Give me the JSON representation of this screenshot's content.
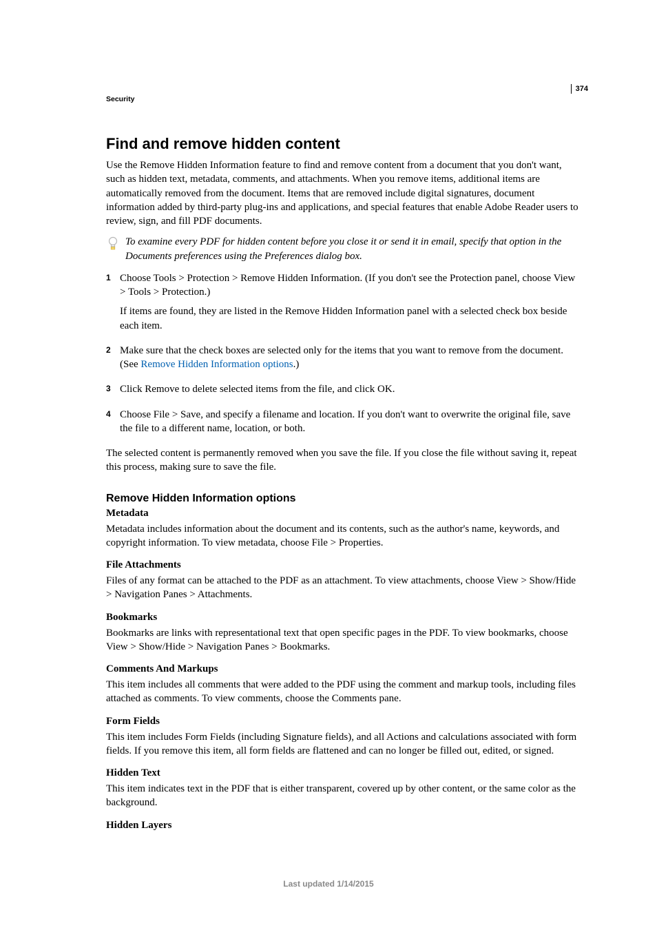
{
  "page_number": "374",
  "breadcrumb": "Security",
  "h1": "Find and remove hidden content",
  "intro": "Use the Remove Hidden Information feature to find and remove content from a document that you don't want, such as hidden text, metadata, comments, and attachments. When you remove items, additional items are automatically removed from the document. Items that are removed include digital signatures, document information added by third-party plug-ins and applications, and special features that enable Adobe Reader users to review, sign, and fill PDF documents.",
  "tip": "To examine every PDF for hidden content before you close it or send it in email, specify that option in the Documents preferences using the Preferences dialog box.",
  "steps": [
    {
      "num": "1",
      "p1": "Choose Tools > Protection > Remove Hidden Information. (If you don't see the Protection panel, choose View > Tools > Protection.)",
      "p2": "If items are found, they are listed in the Remove Hidden Information panel with a selected check box beside each item."
    },
    {
      "num": "2",
      "pre_link": "Make sure that the check boxes are selected only for the items that you want to remove from the document. (See ",
      "link": "Remove Hidden Information options",
      "post_link": ".)"
    },
    {
      "num": "3",
      "p1": "Click Remove to delete selected items from the file, and click OK."
    },
    {
      "num": "4",
      "p1": "Choose File > Save, and specify a filename and location. If you don't want to overwrite the original file, save the file to a different name, location, or both."
    }
  ],
  "after_steps": "The selected content is permanently removed when you save the file. If you close the file without saving it, repeat this process, making sure to save the file.",
  "h2": "Remove Hidden Information options",
  "options": [
    {
      "term": "Metadata",
      "desc": "Metadata includes information about the document and its contents, such as the author's name, keywords, and copyright information. To view metadata, choose File > Properties."
    },
    {
      "term": "File Attachments",
      "desc": "Files of any format can be attached to the PDF as an attachment. To view attachments, choose View > Show/Hide > Navigation Panes > Attachments."
    },
    {
      "term": "Bookmarks",
      "desc": "Bookmarks are links with representational text that open specific pages in the PDF. To view bookmarks, choose View > Show/Hide > Navigation Panes > Bookmarks."
    },
    {
      "term": "Comments And Markups",
      "desc": "This item includes all comments that were added to the PDF using the comment and markup tools, including files attached as comments. To view comments, choose the Comments pane."
    },
    {
      "term": "Form Fields",
      "desc": "This item includes Form Fields (including Signature fields), and all Actions and calculations associated with form fields. If you remove this item, all form fields are flattened and can no longer be filled out, edited, or signed."
    },
    {
      "term": "Hidden Text",
      "desc": "This item indicates text in the PDF that is either transparent, covered up by other content, or the same color as the background."
    },
    {
      "term": "Hidden Layers",
      "desc": ""
    }
  ],
  "footer": "Last updated 1/14/2015"
}
